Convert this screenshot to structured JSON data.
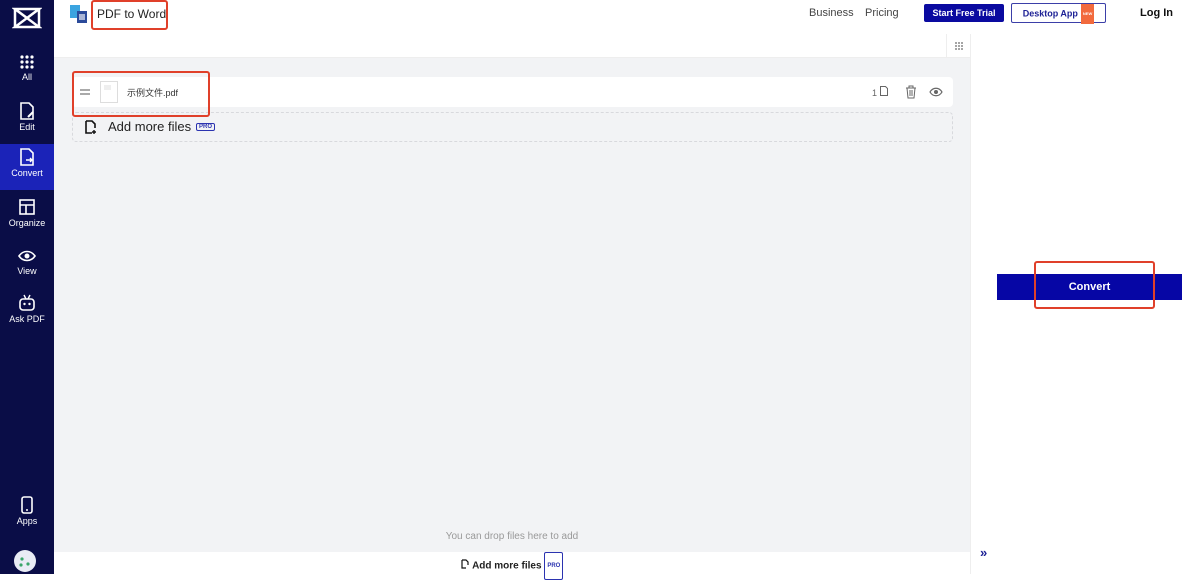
{
  "sidebar": {
    "items": [
      {
        "label": "All"
      },
      {
        "label": "Edit"
      },
      {
        "label": "Convert"
      },
      {
        "label": "Organize"
      },
      {
        "label": "View"
      },
      {
        "label": "Ask PDF"
      }
    ],
    "apps_label": "Apps"
  },
  "header": {
    "title": "PDF to Word",
    "links": [
      "Business",
      "Pricing"
    ],
    "trial_label": "Start Free Trial",
    "desktop_label": "Desktop App",
    "new_badge": "NEW",
    "login_label": "Log In"
  },
  "files": [
    {
      "name": "示例文件.pdf",
      "pages": "1"
    }
  ],
  "add_more_label": "Add more files",
  "pro_badge": "PRO",
  "drop_hint": "You can drop files here to add",
  "convert_label": "Convert",
  "colors": {
    "sidebar": "#0a0d47",
    "accent": "#0606a5",
    "highlight": "#e0402a"
  }
}
